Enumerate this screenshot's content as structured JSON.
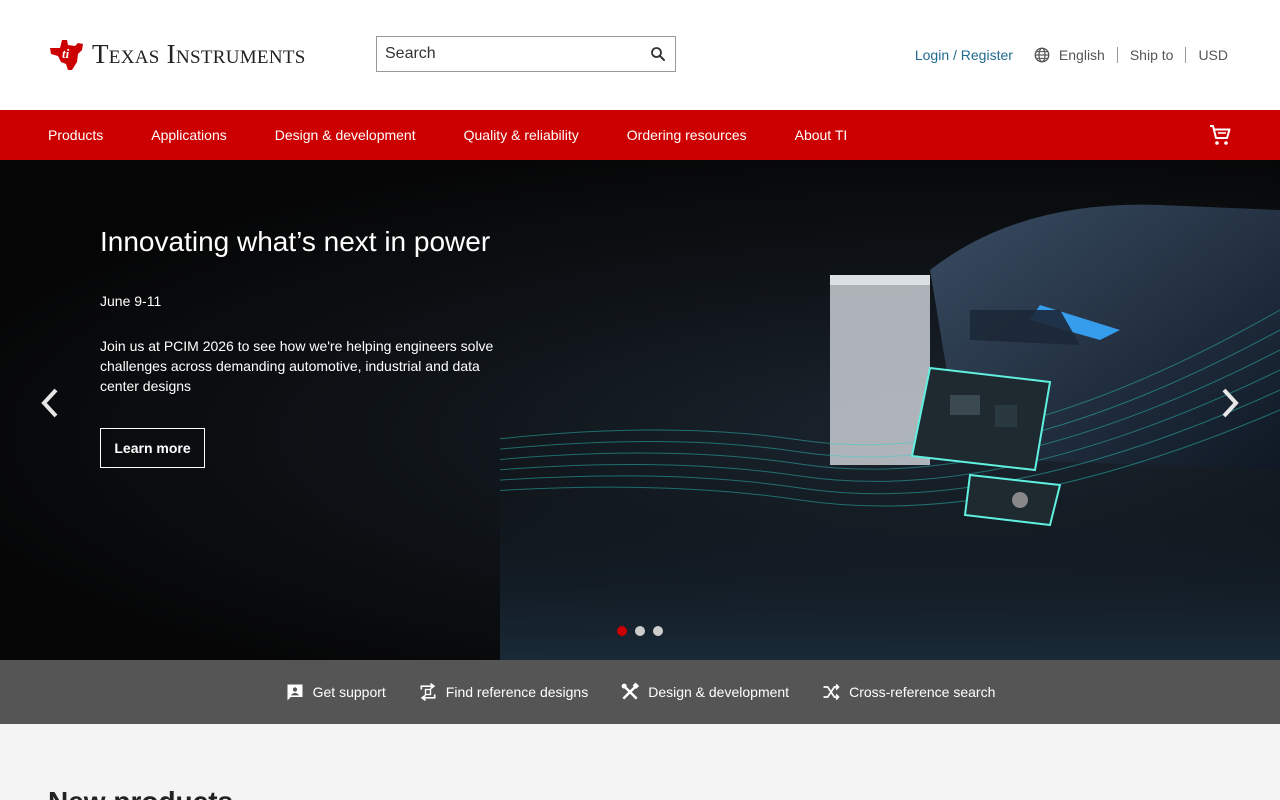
{
  "header": {
    "logo_text": "Texas Instruments",
    "search_placeholder": "Search",
    "login": "Login / Register",
    "language": "English",
    "ship_to": "Ship to",
    "currency": "USD"
  },
  "nav": {
    "items": [
      {
        "label": "Products"
      },
      {
        "label": "Applications"
      },
      {
        "label": "Design & development"
      },
      {
        "label": "Quality & reliability"
      },
      {
        "label": "Ordering resources"
      },
      {
        "label": "About TI"
      }
    ],
    "cart_icon": "shopping-cart-icon"
  },
  "hero": {
    "title": "Innovating what’s next in power",
    "date": "June 9-11",
    "description": "Join us at PCIM 2026 to see how we're helping engineers solve challenges across demanding automotive, industrial and data center designs",
    "cta": "Learn more",
    "slides_total": 3,
    "active_slide": 1
  },
  "quick_links": [
    {
      "label": "Get support",
      "icon": "support-badge-icon"
    },
    {
      "label": "Find reference designs",
      "icon": "reference-designs-icon"
    },
    {
      "label": "Design & development",
      "icon": "tools-icon"
    },
    {
      "label": "Cross-reference search",
      "icon": "shuffle-icon"
    }
  ],
  "section": {
    "title": "New products"
  },
  "colors": {
    "brand_red": "#cc0000",
    "link_blue": "#1f6a8f",
    "quick_bar": "#555555"
  }
}
